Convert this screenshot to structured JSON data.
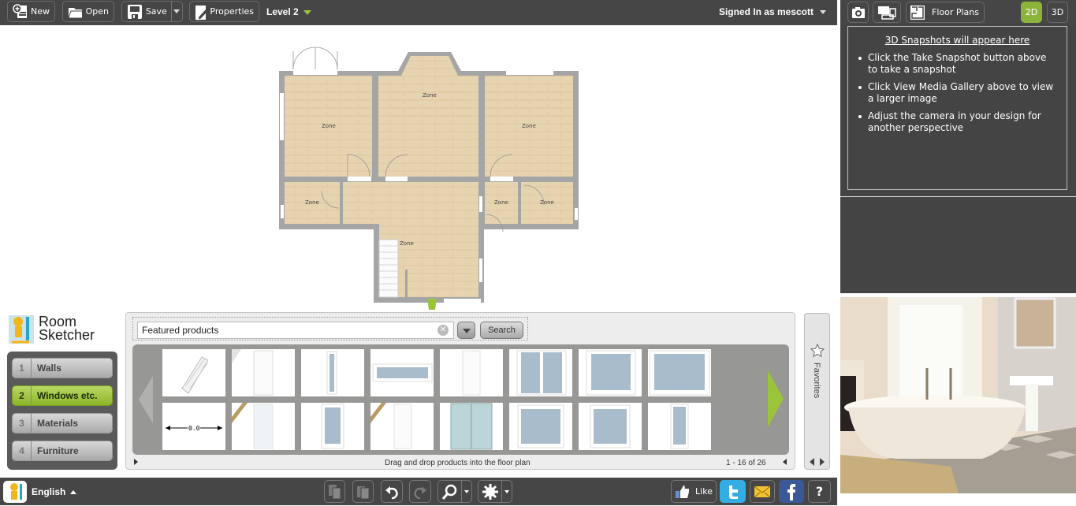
{
  "toolbar": {
    "new_label": "New",
    "open_label": "Open",
    "save_label": "Save",
    "properties_label": "Properties",
    "level_label": "Level 2",
    "signed_in_label": "Signed In as mescott"
  },
  "right_toolbar": {
    "floor_plans_label": "Floor Plans",
    "view_2d_label": "2D",
    "view_3d_label": "3D",
    "active_view": "2D"
  },
  "snapshots": {
    "title": "3D Snapshots will appear here",
    "tips": [
      "Click the Take Snapshot button above to take a snapshot",
      "Click View Media Gallery above to view a larger image",
      "Adjust the camera in your design for another perspective"
    ]
  },
  "floor_plan": {
    "zone_label": "Zone",
    "zones": [
      "Zone",
      "Zone",
      "Zone",
      "Zone",
      "Zone",
      "Zone",
      "Zone"
    ]
  },
  "logo": {
    "line1": "Room",
    "line2": "Sketcher"
  },
  "steps": [
    {
      "num": "1",
      "label": "Walls",
      "active": false
    },
    {
      "num": "2",
      "label": "Windows etc.",
      "active": true
    },
    {
      "num": "3",
      "label": "Materials",
      "active": false
    },
    {
      "num": "4",
      "label": "Furniture",
      "active": false
    }
  ],
  "products": {
    "search_value": "Featured products",
    "search_button": "Search",
    "hint": "Drag and drop products into the floor plan",
    "count": "1 - 16 of 26",
    "items": [
      "staircase",
      "door",
      "narrow-window",
      "wide-window",
      "door",
      "double-window",
      "window",
      "window",
      "dimension-line",
      "glass-door",
      "window",
      "door",
      "double-glass-door",
      "window",
      "window",
      "narrow-window"
    ],
    "dimension_label": "0.0"
  },
  "favorites_label": "Favorites",
  "bottom": {
    "language": "English",
    "like_label": "Like"
  },
  "colors": {
    "accent_green": "#9bc43b",
    "toolbar_bg": "#464646",
    "floor_wood": "#e6d2ae",
    "wall_gray": "#a0a0a0"
  }
}
